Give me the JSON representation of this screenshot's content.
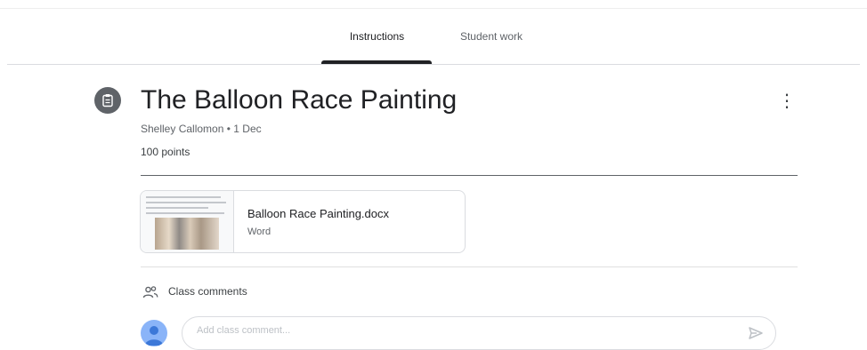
{
  "tabs": [
    {
      "label": "Instructions",
      "active": true
    },
    {
      "label": "Student work",
      "active": false
    }
  ],
  "assignment": {
    "title": "The Balloon Race Painting",
    "author": "Shelley Callomon",
    "separator": "•",
    "date": "1 Dec",
    "points": "100 points",
    "icon": "assignment-icon",
    "more_icon": "more-vert-icon",
    "more_glyph": "⋮"
  },
  "attachment": {
    "name": "Balloon Race Painting.docx",
    "type": "Word",
    "thumbnail_icon": "document-thumbnail"
  },
  "comments": {
    "label": "Class comments",
    "icon": "people-icon",
    "placeholder": "Add class comment...",
    "send_icon": "send-icon"
  },
  "colors": {
    "text_primary": "#202124",
    "text_secondary": "#5f6368",
    "divider": "#dadce0",
    "avatar": "#8ab4f8",
    "icon_bg": "#5f6368"
  }
}
